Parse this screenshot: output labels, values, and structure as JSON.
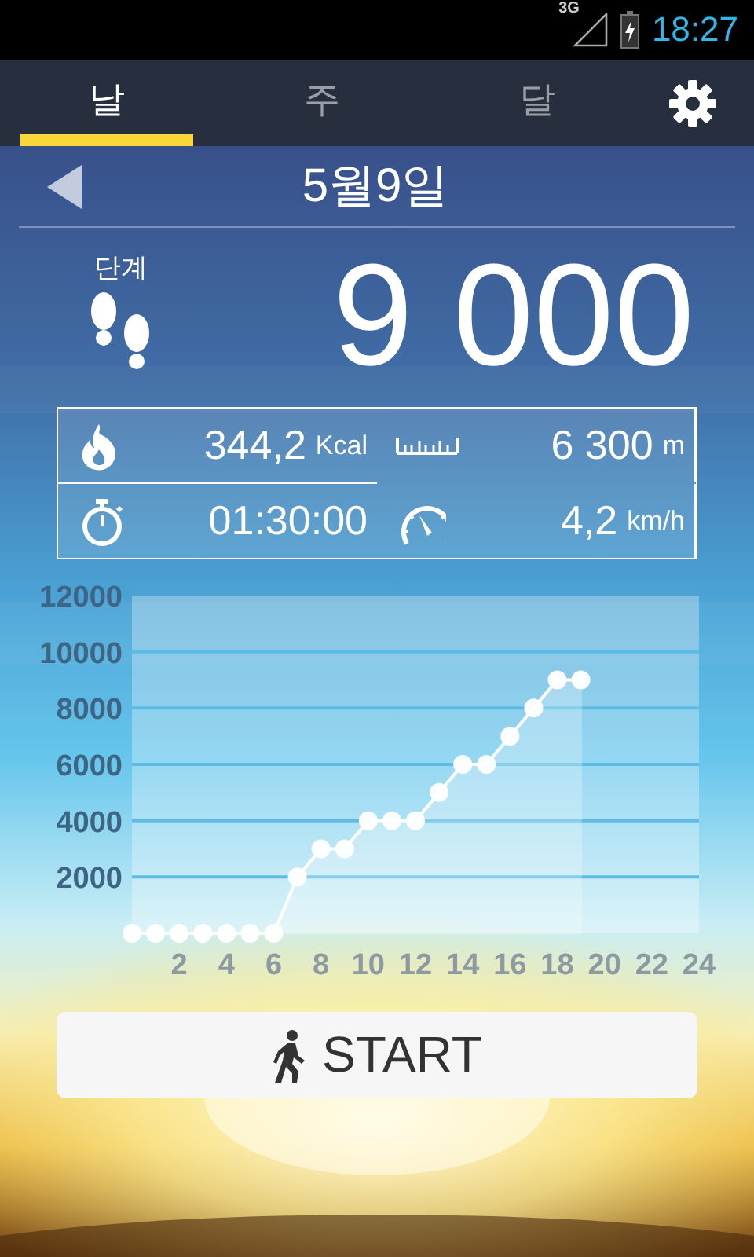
{
  "status_bar": {
    "network": "3G",
    "time": "18:27"
  },
  "tabs": [
    {
      "label": "날",
      "selected": true
    },
    {
      "label": "주",
      "selected": false
    },
    {
      "label": "달",
      "selected": false
    }
  ],
  "date": "5월9일",
  "steps": {
    "label": "단계",
    "value": "9 000"
  },
  "stats": [
    {
      "kind": "calories",
      "value": "344,2",
      "unit": "Kcal"
    },
    {
      "kind": "distance",
      "value": "6 300",
      "unit": "m"
    },
    {
      "kind": "duration",
      "value": "01:30:00"
    },
    {
      "kind": "speed",
      "value": "4,2",
      "unit": "km/h"
    }
  ],
  "chart": {
    "chart_data": {
      "type": "line",
      "x": [
        0,
        1,
        2,
        3,
        4,
        5,
        6,
        7,
        8,
        9,
        10,
        11,
        12,
        13,
        14,
        15,
        16,
        17,
        18,
        19
      ],
      "grid": true,
      "series": [
        {
          "color": "#ffffff",
          "marker": true,
          "values": [
            0,
            0,
            0,
            0,
            0,
            0,
            0,
            2000,
            3000,
            3000,
            4000,
            4000,
            4000,
            5000,
            6000,
            6000,
            7000,
            8000,
            9000,
            9000
          ]
        }
      ],
      "xlim": [
        0,
        24
      ],
      "ylim": [
        0,
        12000
      ],
      "xticks": [
        2,
        4,
        6,
        8,
        10,
        12,
        14,
        16,
        18,
        20,
        22,
        24
      ],
      "yticks": [
        2000,
        4000,
        6000,
        8000,
        10000,
        12000
      ]
    }
  },
  "start_button": {
    "label": "START"
  }
}
